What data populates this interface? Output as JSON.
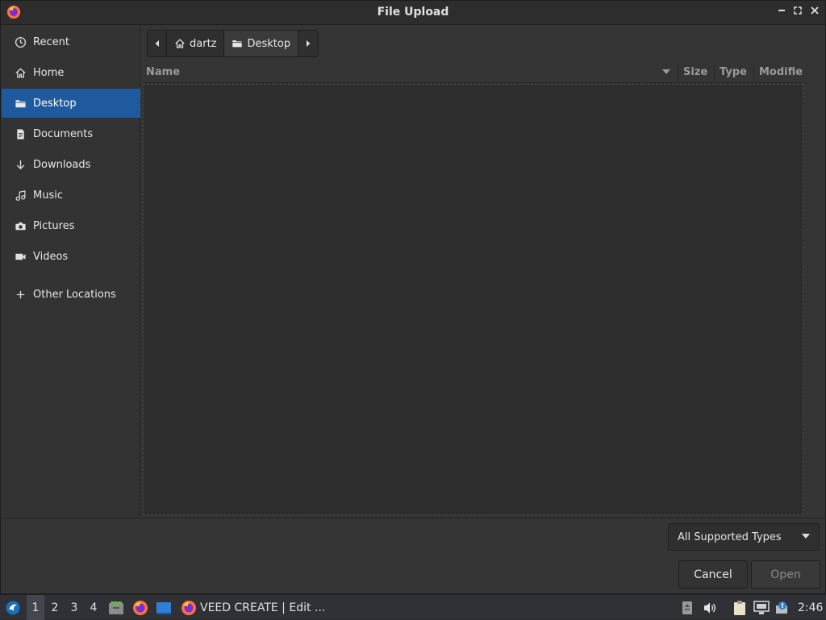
{
  "window": {
    "title": "File Upload"
  },
  "sidebar": {
    "items": [
      {
        "label": "Recent",
        "icon": "clock-icon"
      },
      {
        "label": "Home",
        "icon": "home-icon"
      },
      {
        "label": "Desktop",
        "icon": "folder-icon",
        "active": true
      },
      {
        "label": "Documents",
        "icon": "document-icon"
      },
      {
        "label": "Downloads",
        "icon": "download-icon"
      },
      {
        "label": "Music",
        "icon": "music-icon"
      },
      {
        "label": "Pictures",
        "icon": "camera-icon"
      },
      {
        "label": "Videos",
        "icon": "video-icon"
      },
      {
        "label": "Other Locations",
        "icon": "plus-icon"
      }
    ]
  },
  "pathbar": {
    "segments": [
      "dartz",
      "Desktop"
    ]
  },
  "list": {
    "columns": {
      "name": "Name",
      "size": "Size",
      "type": "Type",
      "modified": "Modifie"
    }
  },
  "footer": {
    "filter_value": "All Supported Types",
    "cancel_label": "Cancel",
    "open_label": "Open"
  },
  "taskbar": {
    "workspaces": [
      "1",
      "2",
      "3",
      "4"
    ],
    "active_workspace": "1",
    "task_label": "VEED CREATE | Edit ...",
    "clock": "2:46"
  },
  "colors": {
    "accent": "#1f5a9e",
    "window_bg": "#353535",
    "list_bg": "#2d2d2d"
  }
}
